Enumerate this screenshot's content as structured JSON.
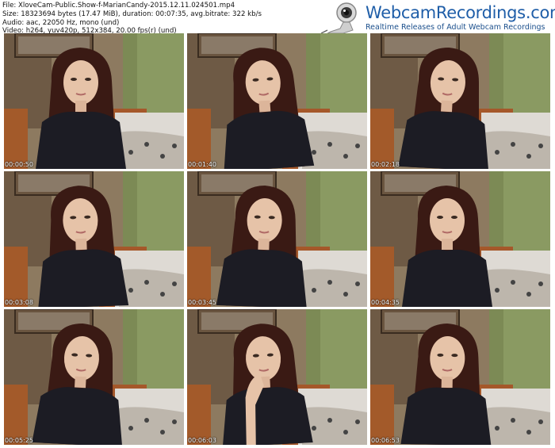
{
  "meta": {
    "file": "File: XloveCam-Public.Show-f-MarianCandy-2015.12.11.024501.mp4",
    "size": "Size: 18323694 bytes (17.47 MiB), duration: 00:07:35, avg.bitrate: 322 kb/s",
    "audio": "Audio: aac, 22050 Hz, mono (und)",
    "video": "Video: h264, yuv420p, 512x384, 20.00 fps(r) (und)"
  },
  "logo": {
    "title": "WebcamRecordings.com",
    "tagline": "Realtime Releases of Adult Webcam Recordings",
    "icon": "webcam-icon"
  },
  "thumbnails": [
    {
      "time": "00:00:50"
    },
    {
      "time": "00:01:40"
    },
    {
      "time": "00:02:18"
    },
    {
      "time": "00:03:08"
    },
    {
      "time": "00:03:45"
    },
    {
      "time": "00:04:35"
    },
    {
      "time": "00:05:25"
    },
    {
      "time": "00:06:03"
    },
    {
      "time": "00:06:53"
    }
  ]
}
